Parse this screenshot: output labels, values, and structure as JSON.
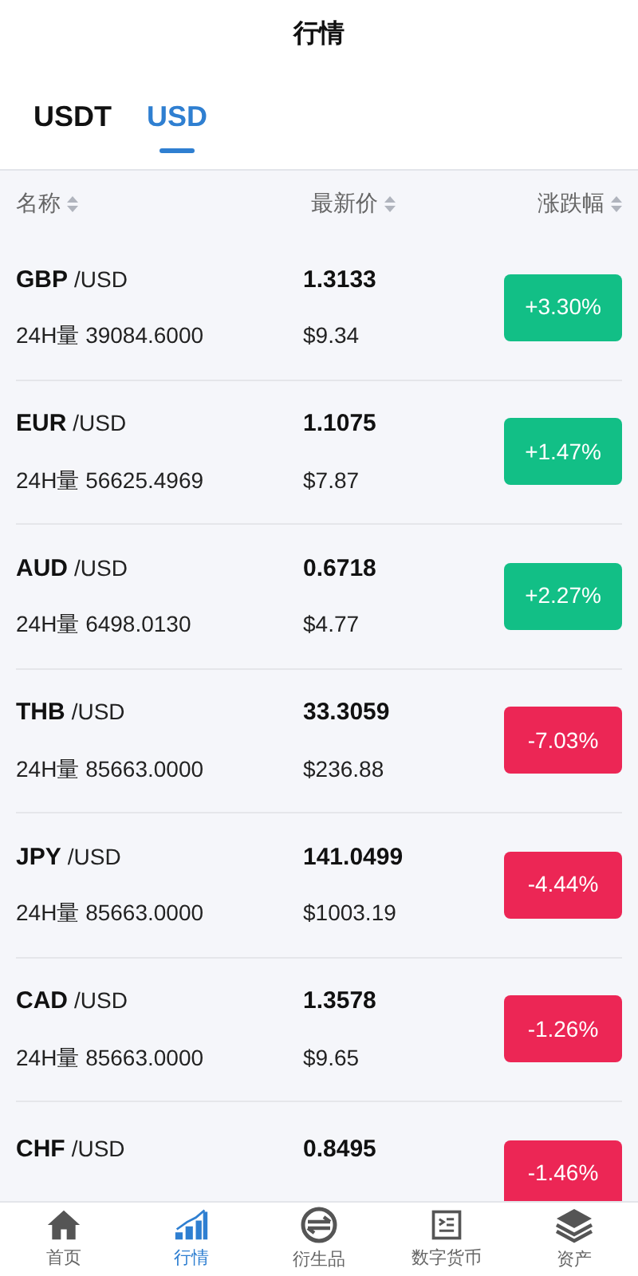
{
  "title": "行情",
  "tabs": [
    {
      "label": "USDT",
      "selected": false
    },
    {
      "label": "USD",
      "selected": true
    }
  ],
  "columns": [
    "名称",
    "最新价",
    "涨跌幅"
  ],
  "rows": [
    {
      "symbol": "GBP",
      "quote": "/USD",
      "volume": "24H量 39084.6000",
      "price": "1.3133",
      "price_usd": "$9.34",
      "change": "+3.30%",
      "kind": "up"
    },
    {
      "symbol": "EUR",
      "quote": "/USD",
      "volume": "24H量 56625.4969",
      "price": "1.1075",
      "price_usd": "$7.87",
      "change": "+1.47%",
      "kind": "up"
    },
    {
      "symbol": "AUD",
      "quote": "/USD",
      "volume": "24H量 6498.0130",
      "price": "0.6718",
      "price_usd": "$4.77",
      "change": "+2.27%",
      "kind": "up"
    },
    {
      "symbol": "THB",
      "quote": "/USD",
      "volume": "24H量 85663.0000",
      "price": "33.3059",
      "price_usd": "$236.88",
      "change": "-7.03%",
      "kind": "down"
    },
    {
      "symbol": "JPY",
      "quote": "/USD",
      "volume": "24H量 85663.0000",
      "price": "141.0499",
      "price_usd": "$1003.19",
      "change": "-4.44%",
      "kind": "down"
    },
    {
      "symbol": "CAD",
      "quote": "/USD",
      "volume": "24H量 85663.0000",
      "price": "1.3578",
      "price_usd": "$9.65",
      "change": "-1.26%",
      "kind": "down"
    },
    {
      "symbol": "CHF",
      "quote": "/USD",
      "price": "0.8495",
      "change": "-1.46%",
      "kind": "down"
    }
  ],
  "nav": [
    {
      "label": "首页",
      "kind": "home",
      "selected": false
    },
    {
      "label": "行情",
      "kind": "chart",
      "selected": true
    },
    {
      "label": "衍生品",
      "kind": "swap",
      "selected": false
    },
    {
      "label": "数字货币",
      "kind": "doc",
      "selected": false
    },
    {
      "label": "资产",
      "kind": "layers",
      "selected": false
    }
  ]
}
